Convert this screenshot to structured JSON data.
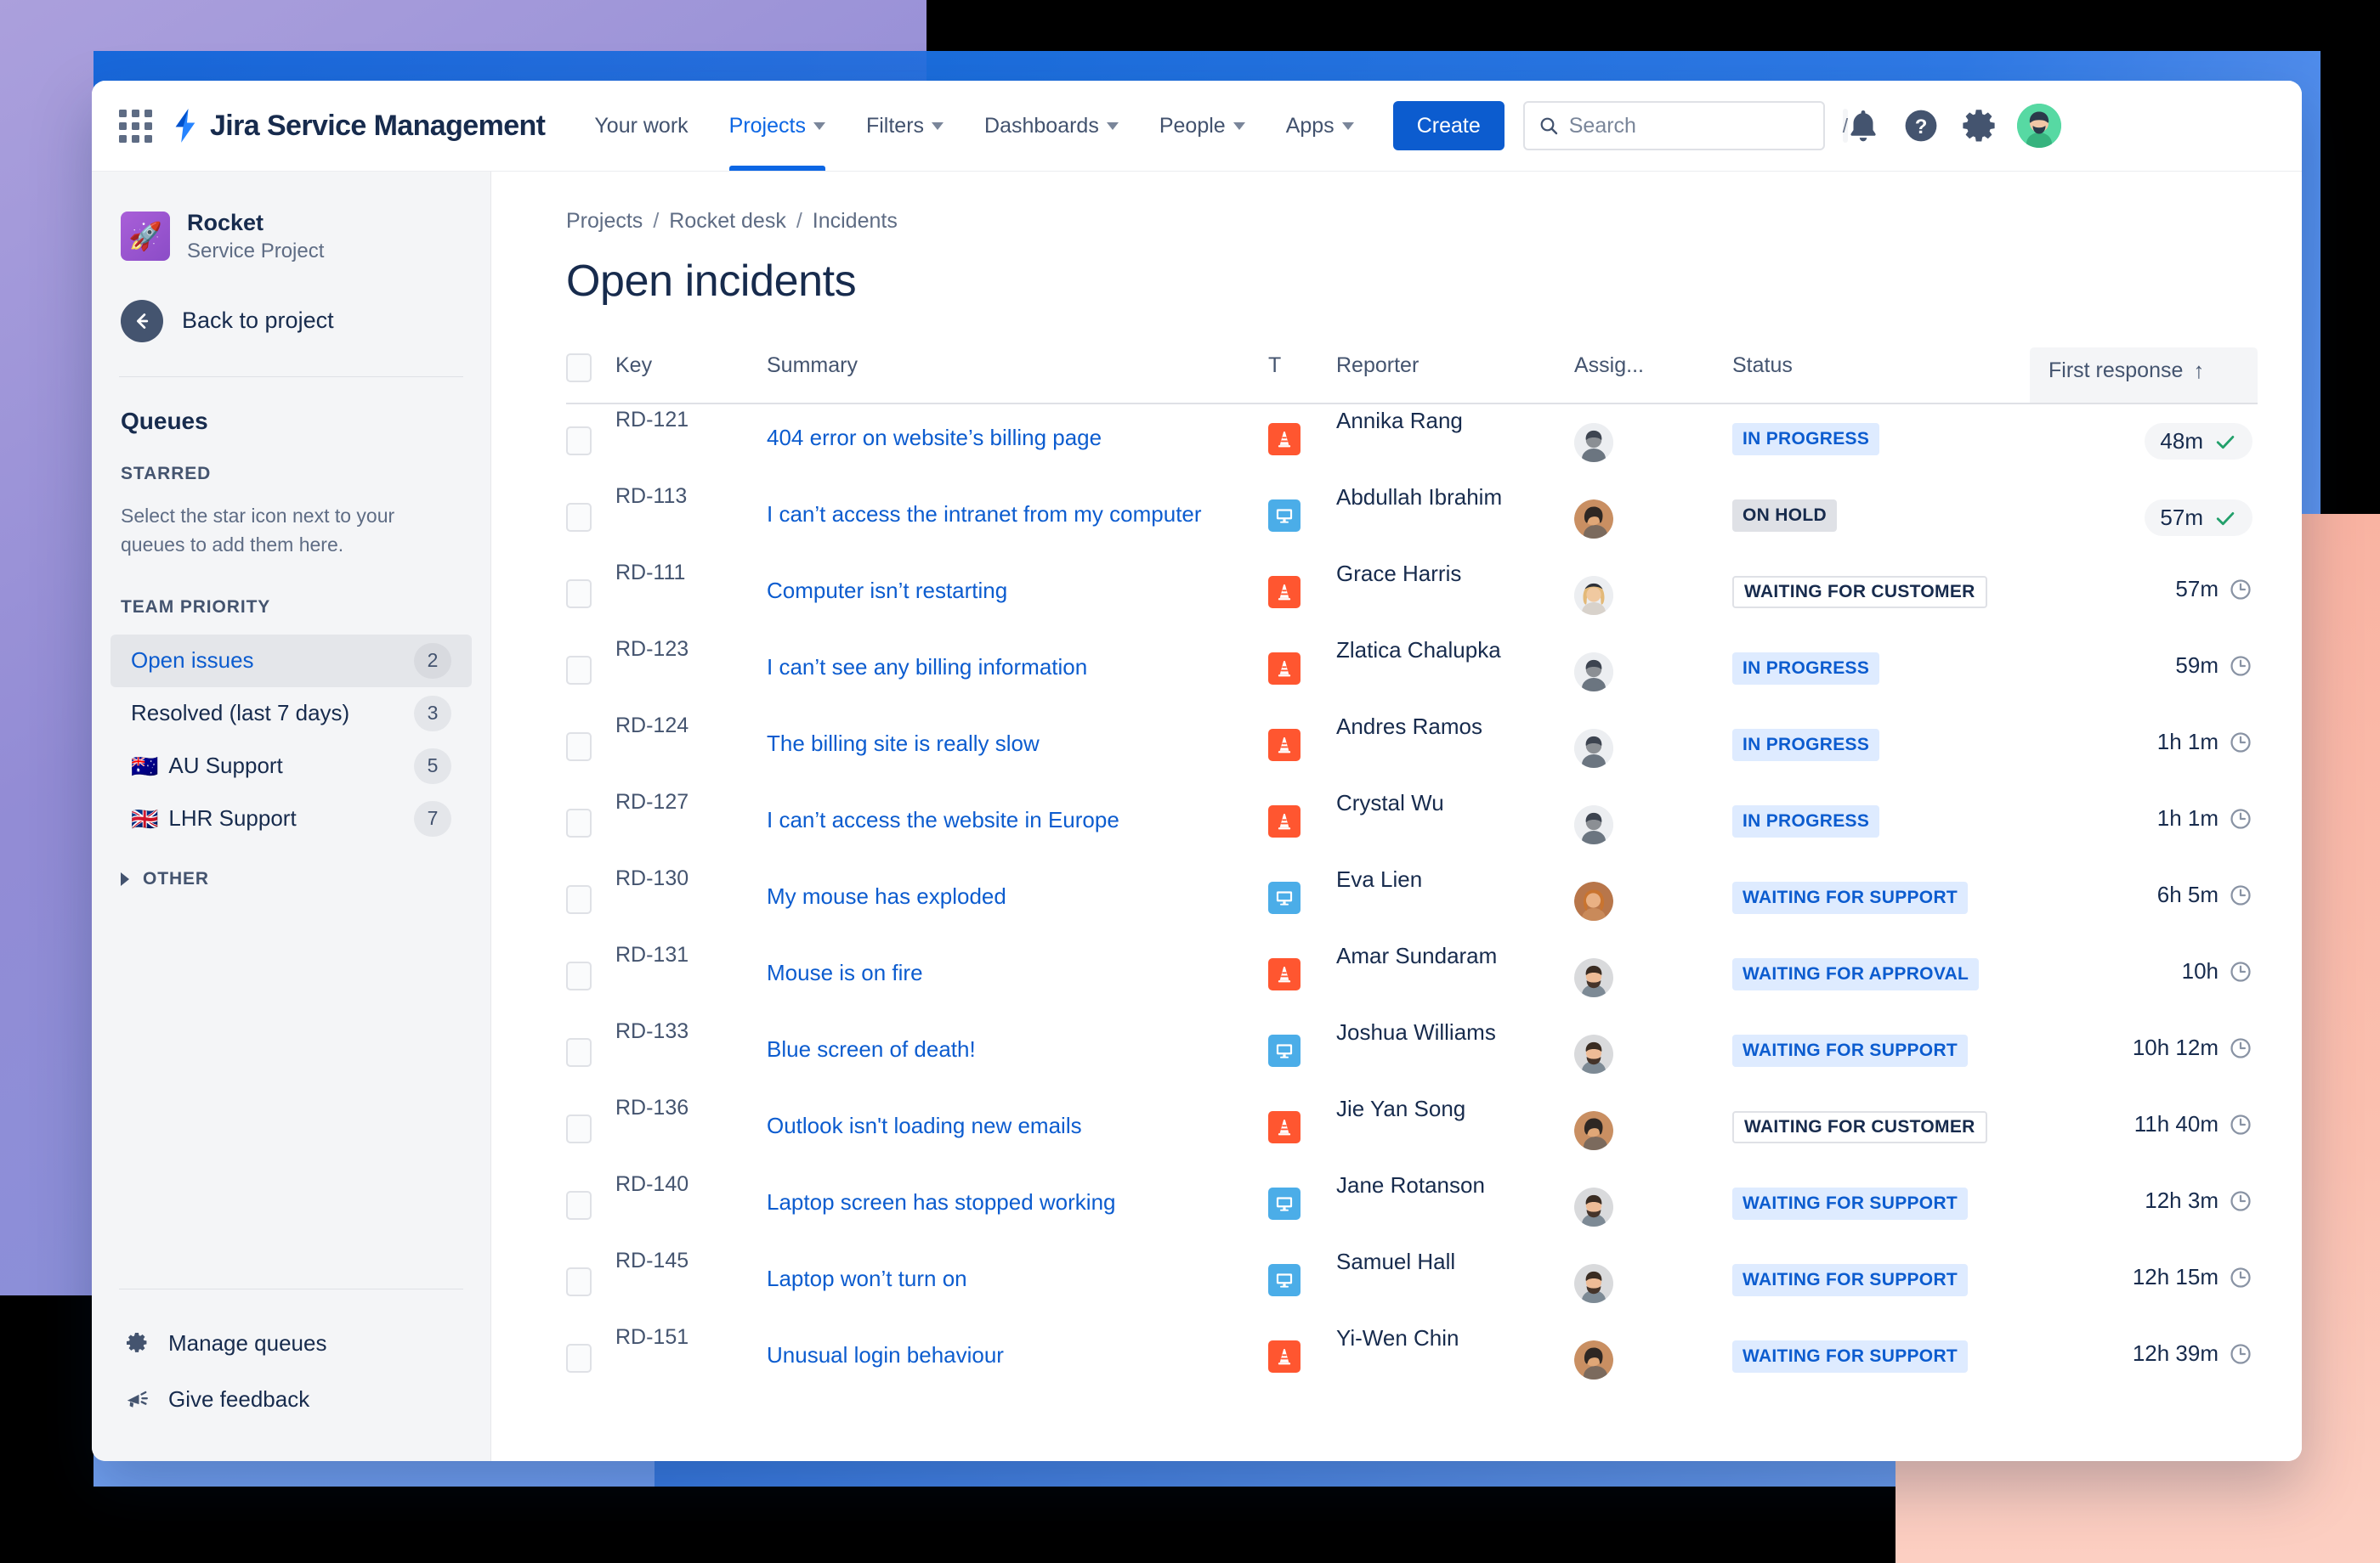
{
  "topnav": {
    "apps_icon": "app-switcher-icon",
    "brand": "Jira Service Management",
    "items": [
      {
        "label": "Your work",
        "has_caret": false,
        "active": false
      },
      {
        "label": "Projects",
        "has_caret": true,
        "active": true
      },
      {
        "label": "Filters",
        "has_caret": true,
        "active": false
      },
      {
        "label": "Dashboards",
        "has_caret": true,
        "active": false
      },
      {
        "label": "People",
        "has_caret": true,
        "active": false
      },
      {
        "label": "Apps",
        "has_caret": true,
        "active": false
      }
    ],
    "create_label": "Create",
    "search_placeholder": "Search",
    "search_value": "",
    "search_shortcut": "/",
    "icons": [
      "notifications-bell-icon",
      "help-icon",
      "settings-gear-icon",
      "user-avatar"
    ]
  },
  "sidebar": {
    "project_name": "Rocket",
    "project_type": "Service Project",
    "back_label": "Back to project",
    "queues_title": "Queues",
    "starred_label": "STARRED",
    "starred_help": "Select the star icon next to your queues to add them here.",
    "team_priority_label": "TEAM PRIORITY",
    "queues": [
      {
        "label": "Open issues",
        "count": "2",
        "flag": "",
        "selected": true
      },
      {
        "label": "Resolved (last 7 days)",
        "count": "3",
        "flag": "",
        "selected": false
      },
      {
        "label": "AU Support",
        "count": "5",
        "flag": "🇦🇺",
        "selected": false
      },
      {
        "label": "LHR Support",
        "count": "7",
        "flag": "🇬🇧",
        "selected": false
      }
    ],
    "other_label": "OTHER",
    "manage_queues_label": "Manage queues",
    "give_feedback_label": "Give feedback"
  },
  "main": {
    "breadcrumb": [
      "Projects",
      "Rocket desk",
      "Incidents"
    ],
    "breadcrumb_separator": "/",
    "page_title": "Open incidents",
    "columns": {
      "key": "Key",
      "summary": "Summary",
      "type": "T",
      "reporter": "Reporter",
      "assignee": "Assig...",
      "status": "Status",
      "first_response": "First response",
      "sort_arrow": "↑"
    },
    "rows": [
      {
        "key": "RD-121",
        "summary": "404 error on website’s billing page",
        "type": "incident",
        "reporter": "Annika Rang",
        "assignee_avatar": "avatar-man-grey",
        "status": "IN PROGRESS",
        "status_style": "inprogress",
        "first_response": "48m",
        "sla_state": "met"
      },
      {
        "key": "RD-113",
        "summary": "I can’t access the intranet from my computer",
        "type": "itservice",
        "reporter": "Abdullah Ibrahim",
        "assignee_avatar": "avatar-woman-brown",
        "status": "ON HOLD",
        "status_style": "onhold",
        "first_response": "57m",
        "sla_state": "met"
      },
      {
        "key": "RD-111",
        "summary": "Computer isn’t restarting",
        "type": "incident",
        "reporter": "Grace Harris",
        "assignee_avatar": "avatar-woman-blonde",
        "status": "WAITING FOR CUSTOMER",
        "status_style": "waitcust",
        "first_response": "57m",
        "sla_state": "pending"
      },
      {
        "key": "RD-123",
        "summary": "I can’t see any billing information",
        "type": "incident",
        "reporter": "Zlatica Chalupka",
        "assignee_avatar": "avatar-man-grey",
        "status": "IN PROGRESS",
        "status_style": "inprogress",
        "first_response": "59m",
        "sla_state": "pending"
      },
      {
        "key": "RD-124",
        "summary": "The billing site is really slow",
        "type": "incident",
        "reporter": "Andres Ramos",
        "assignee_avatar": "avatar-man-grey",
        "status": "IN PROGRESS",
        "status_style": "inprogress",
        "first_response": "1h 1m",
        "sla_state": "pending"
      },
      {
        "key": "RD-127",
        "summary": "I can’t access the website in Europe",
        "type": "incident",
        "reporter": "Crystal Wu",
        "assignee_avatar": "avatar-man-grey",
        "status": "IN PROGRESS",
        "status_style": "inprogress",
        "first_response": "1h 1m",
        "sla_state": "pending"
      },
      {
        "key": "RD-130",
        "summary": "My mouse has exploded",
        "type": "itservice",
        "reporter": "Eva Lien",
        "assignee_avatar": "avatar-woman-ginger",
        "status": "WAITING FOR SUPPORT",
        "status_style": "waitsup",
        "first_response": "6h 5m",
        "sla_state": "pending"
      },
      {
        "key": "RD-131",
        "summary": "Mouse is on fire",
        "type": "incident",
        "reporter": "Amar Sundaram",
        "assignee_avatar": "avatar-man-beard",
        "status": "WAITING FOR APPROVAL",
        "status_style": "waitappr",
        "first_response": "10h",
        "sla_state": "pending"
      },
      {
        "key": "RD-133",
        "summary": "Blue screen of death!",
        "type": "itservice",
        "reporter": "Joshua Williams",
        "assignee_avatar": "avatar-man-beard",
        "status": "WAITING FOR SUPPORT",
        "status_style": "waitsup",
        "first_response": "10h 12m",
        "sla_state": "pending"
      },
      {
        "key": "RD-136",
        "summary": "Outlook isn't loading new emails",
        "type": "incident",
        "reporter": "Jie Yan Song",
        "assignee_avatar": "avatar-woman-brown",
        "status": "WAITING FOR CUSTOMER",
        "status_style": "waitcust",
        "first_response": "11h 40m",
        "sla_state": "pending"
      },
      {
        "key": "RD-140",
        "summary": "Laptop screen has stopped working",
        "type": "itservice",
        "reporter": "Jane Rotanson",
        "assignee_avatar": "avatar-man-beard",
        "status": "WAITING FOR SUPPORT",
        "status_style": "waitsup",
        "first_response": "12h 3m",
        "sla_state": "pending"
      },
      {
        "key": "RD-145",
        "summary": "Laptop won’t turn on",
        "type": "itservice",
        "reporter": "Samuel Hall",
        "assignee_avatar": "avatar-man-beard",
        "status": "WAITING FOR SUPPORT",
        "status_style": "waitsup",
        "first_response": "12h 15m",
        "sla_state": "pending"
      },
      {
        "key": "RD-151",
        "summary": "Unusual login behaviour",
        "type": "incident",
        "reporter": "Yi-Wen Chin",
        "assignee_avatar": "avatar-woman-brown",
        "status": "WAITING FOR SUPPORT",
        "status_style": "waitsup",
        "first_response": "12h 39m",
        "sla_state": "pending"
      }
    ]
  },
  "colors": {
    "brand_blue": "#0c66e4",
    "create_blue": "#0c5ccf",
    "incident_orange": "#ff5630",
    "itservice_blue": "#4bade8",
    "sla_met_green": "#22a06b",
    "text_dark": "#172b4d",
    "text_subtle": "#5e6c84"
  }
}
